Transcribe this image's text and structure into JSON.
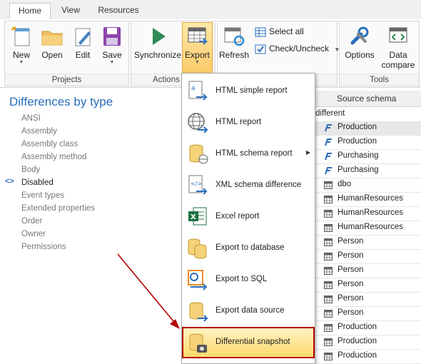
{
  "tabs": [
    "Home",
    "View",
    "Resources"
  ],
  "ribbon": {
    "projects": {
      "label": "Projects",
      "new": "New",
      "open": "Open",
      "edit": "Edit",
      "save": "Save"
    },
    "actions": {
      "label": "Actions",
      "synchronize": "Synchronize",
      "export": "Export"
    },
    "middle": {
      "refresh": "Refresh",
      "select_all": "Select all",
      "check_uncheck": "Check/Uncheck"
    },
    "tools": {
      "label": "Tools",
      "options": "Options",
      "data_compare_1": "Data",
      "data_compare_2": "compare"
    }
  },
  "left_panel": {
    "title": "Differences by type",
    "selected": "Disabled",
    "items": [
      "ANSI",
      "Assembly",
      "Assembly class",
      "Assembly method",
      "Body",
      "Disabled",
      "Event types",
      "Extended properties",
      "Order",
      "Owner",
      "Permissions"
    ]
  },
  "grid": {
    "header": "Source schema",
    "subheader": "different",
    "rows": [
      {
        "schema": "Production",
        "icon": "function-icon"
      },
      {
        "schema": "Production",
        "icon": "function-icon"
      },
      {
        "schema": "Purchasing",
        "icon": "function-icon"
      },
      {
        "schema": "Purchasing",
        "icon": "function-icon"
      },
      {
        "schema": "dbo",
        "icon": "table-icon"
      },
      {
        "schema": "HumanResources",
        "icon": "table-icon"
      },
      {
        "schema": "HumanResources",
        "icon": "table-icon"
      },
      {
        "schema": "HumanResources",
        "icon": "table-icon"
      },
      {
        "schema": "Person",
        "icon": "table-icon"
      },
      {
        "schema": "Person",
        "icon": "table-icon"
      },
      {
        "schema": "Person",
        "icon": "table-icon"
      },
      {
        "schema": "Person",
        "icon": "table-icon"
      },
      {
        "schema": "Person",
        "icon": "table-icon"
      },
      {
        "schema": "Person",
        "icon": "table-icon"
      },
      {
        "schema": "Production",
        "icon": "table-icon"
      },
      {
        "schema": "Production",
        "icon": "table-icon"
      },
      {
        "schema": "Production",
        "icon": "table-icon"
      }
    ]
  },
  "export_menu": {
    "items": [
      {
        "label": "HTML simple report",
        "icon": "html-simple-report-icon"
      },
      {
        "label": "HTML report",
        "icon": "globe-icon"
      },
      {
        "label": "HTML schema report",
        "icon": "database-html-icon",
        "submenu": true
      },
      {
        "label": "XML schema difference",
        "icon": "xml-file-icon"
      },
      {
        "label": "Excel report",
        "icon": "excel-icon"
      },
      {
        "label": "Export to database",
        "icon": "database-export-icon"
      },
      {
        "label": "Export to SQL",
        "icon": "sql-export-icon"
      },
      {
        "label": "Export data source",
        "icon": "data-source-icon"
      },
      {
        "label": "Differential snapshot",
        "icon": "snapshot-icon",
        "highlighted": true
      }
    ]
  },
  "colors": {
    "accent": "#2a6ebb",
    "highlight_border": "#b40000",
    "annotation_arrow": "#b40000",
    "export_button": "#fbc96a"
  }
}
